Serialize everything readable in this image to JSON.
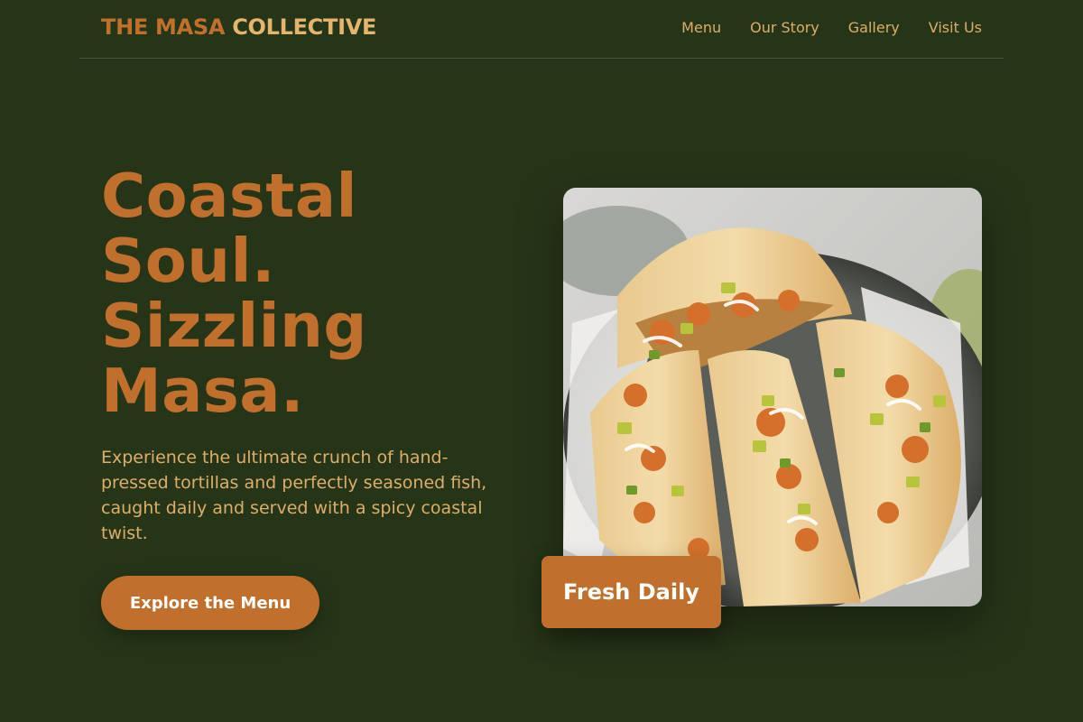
{
  "brand": {
    "name_part1": "THE MASA",
    "name_part2": "COLLECTIVE"
  },
  "nav": {
    "items": [
      {
        "label": "Menu"
      },
      {
        "label": "Our Story"
      },
      {
        "label": "Gallery"
      },
      {
        "label": "Visit Us"
      }
    ]
  },
  "hero": {
    "headline_lines": [
      "Coastal",
      "Soul.",
      "Sizzling",
      "Masa."
    ],
    "description": "Experience the ultimate crunch of hand-pressed tortillas and perfectly seasoned fish, caught daily and served with a spicy coastal twist.",
    "cta_label": "Explore the Menu",
    "badge_label": "Fresh Daily",
    "image_alt": "Shrimp tacos with avocado, slaw and crema"
  },
  "colors": {
    "background": "#263518",
    "accent": "#c0702c",
    "text_light": "#dcae6a",
    "logo_light": "#e3b56f"
  }
}
